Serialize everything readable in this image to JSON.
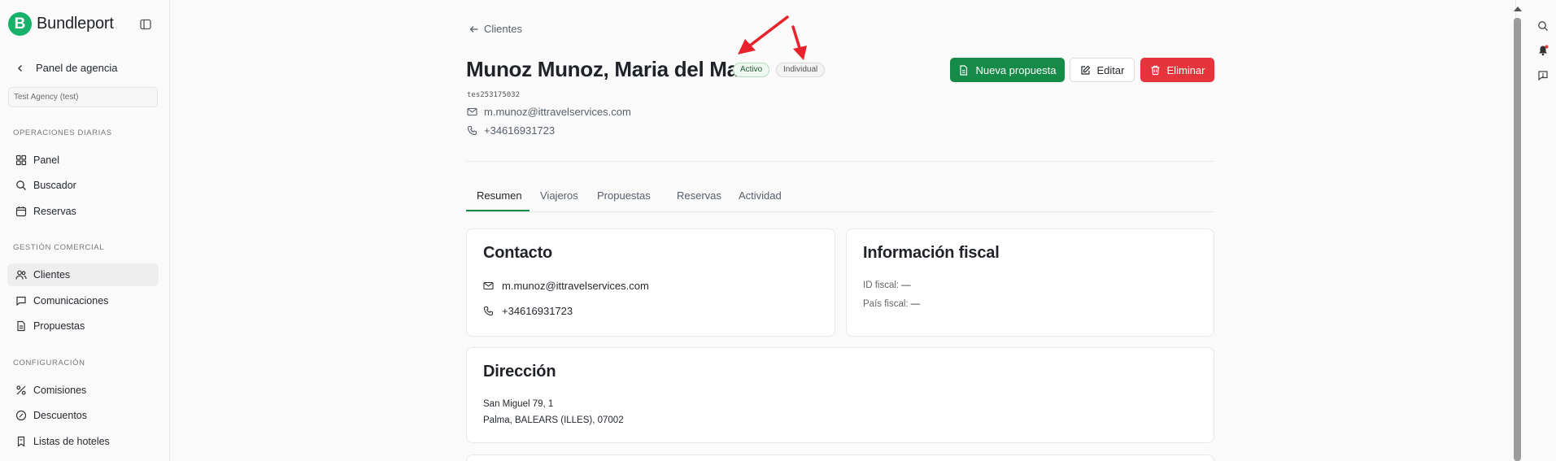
{
  "brand": {
    "name": "Bundleport",
    "logo_letter": "B"
  },
  "sidebar": {
    "back_label": "Panel de agencia",
    "agency_value": "Test Agency (test)",
    "sections": [
      {
        "title": "OPERACIONES DIARIAS",
        "items": [
          {
            "label": "Panel",
            "icon": "grid-icon"
          },
          {
            "label": "Buscador",
            "icon": "search-icon"
          },
          {
            "label": "Reservas",
            "icon": "calendar-icon"
          }
        ]
      },
      {
        "title": "GESTIÓN COMERCIAL",
        "items": [
          {
            "label": "Clientes",
            "icon": "users-icon",
            "active": true
          },
          {
            "label": "Comunicaciones",
            "icon": "message-icon"
          },
          {
            "label": "Propuestas",
            "icon": "file-icon"
          }
        ]
      },
      {
        "title": "CONFIGURACIÓN",
        "items": [
          {
            "label": "Comisiones",
            "icon": "percent-icon"
          },
          {
            "label": "Descuentos",
            "icon": "badge-percent-icon"
          },
          {
            "label": "Listas de hoteles",
            "icon": "bookmark-icon"
          }
        ]
      }
    ]
  },
  "header": {
    "back_label": "Clientes",
    "client_name": "Munoz Munoz, Maria del Mar",
    "status_badge": "Activo",
    "type_badge": "Individual",
    "code": "tes253175032",
    "email": "m.munoz@ittravelservices.com",
    "phone": "+34616931723"
  },
  "actions": {
    "new_proposal": "Nueva propuesta",
    "edit": "Editar",
    "delete": "Eliminar"
  },
  "tabs": [
    {
      "label": "Resumen",
      "active": true
    },
    {
      "label": "Viajeros"
    },
    {
      "label": "Propuestas"
    },
    {
      "label": "Reservas"
    },
    {
      "label": "Actividad"
    }
  ],
  "contact_card": {
    "title": "Contacto",
    "email": "m.munoz@ittravelservices.com",
    "phone": "+34616931723"
  },
  "fiscal_card": {
    "title": "Información fiscal",
    "tax_id_label": "ID fiscal:",
    "tax_id_value": "—",
    "country_label": "País fiscal:",
    "country_value": "—"
  },
  "address_card": {
    "title": "Dirección",
    "line1": "San Miguel 79, 1",
    "line2": "Palma, BALEARS (ILLES), 07002"
  },
  "colors": {
    "brand_green": "#17b26a",
    "primary_button": "#168a47",
    "danger_button": "#e5343c",
    "annotation_red": "#e8222a"
  }
}
